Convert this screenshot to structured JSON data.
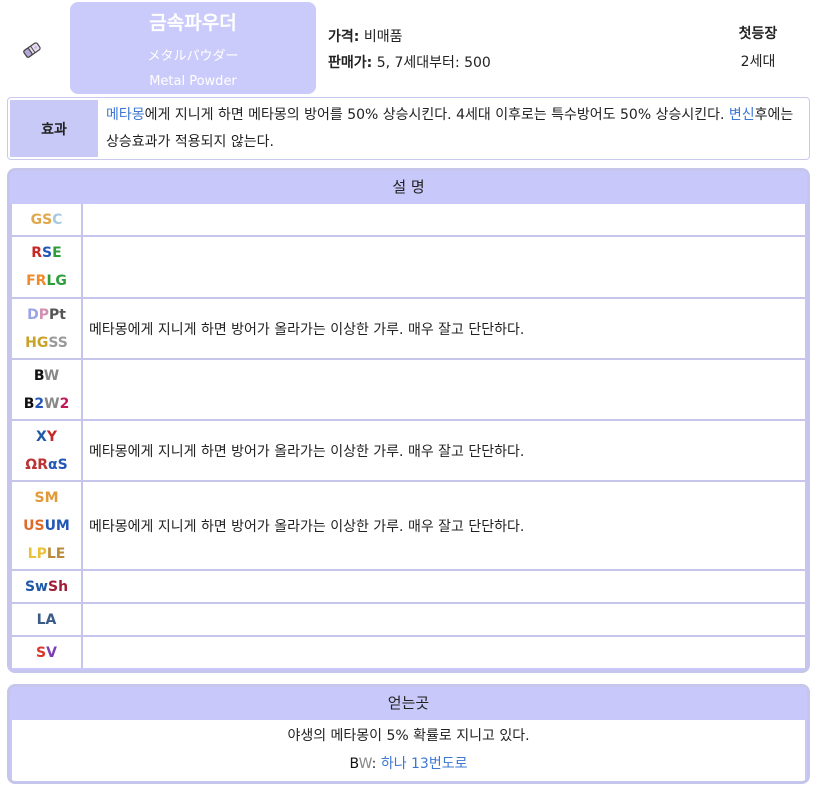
{
  "item": {
    "name_ko": "금속파우더",
    "name_ja": "メタルパウダー",
    "name_en": "Metal Powder",
    "icon": "metal-powder-item-icon"
  },
  "price": {
    "price_label": "가격:",
    "price_value": "비매품",
    "sell_label": "판매가:",
    "sell_value": "5, 7세대부터: 500"
  },
  "first_gen": {
    "label": "첫등장",
    "value": "2세대"
  },
  "effect": {
    "label": "효과",
    "link1": "메타몽",
    "text1": "에게 지니게 하면 메타몽의 방어를 50% 상승시킨다. 4세대 이후로는 특수방어도 50% 상승시킨다. ",
    "link2": "변신",
    "text2": "후에는 상승효과가 적용되지 않는다."
  },
  "description": {
    "title": "설 명",
    "rows": [
      {
        "gen": [
          "GSC"
        ],
        "text": ""
      },
      {
        "gen": [
          "RSE",
          "FRLG"
        ],
        "text": ""
      },
      {
        "gen": [
          "DPPt",
          "HGSS"
        ],
        "text": "메타몽에게 지니게 하면 방어가 올라가는 이상한 가루. 매우 잘고 단단하다."
      },
      {
        "gen": [
          "BW",
          "B2W2"
        ],
        "text": ""
      },
      {
        "gen": [
          "XY",
          "ΩRαS"
        ],
        "text": "메타몽에게 지니게 하면 방어가 올라가는 이상한 가루. 매우 잘고 단단하다."
      },
      {
        "gen": [
          "SM",
          "USUM",
          "LPLE"
        ],
        "text": "메타몽에게 지니게 하면 방어가 올라가는 이상한 가루. 매우 잘고 단단하다."
      },
      {
        "gen": [
          "SwSh"
        ],
        "text": ""
      },
      {
        "gen": [
          "LA"
        ],
        "text": ""
      },
      {
        "gen": [
          "SV"
        ],
        "text": ""
      }
    ]
  },
  "location": {
    "title": "얻는곳",
    "line1": "야생의 메타몽이 5% 확률로 지니고 있다.",
    "line2_gen": "BW",
    "line2_sep": ": ",
    "line2_link": "하나 13번도로"
  }
}
